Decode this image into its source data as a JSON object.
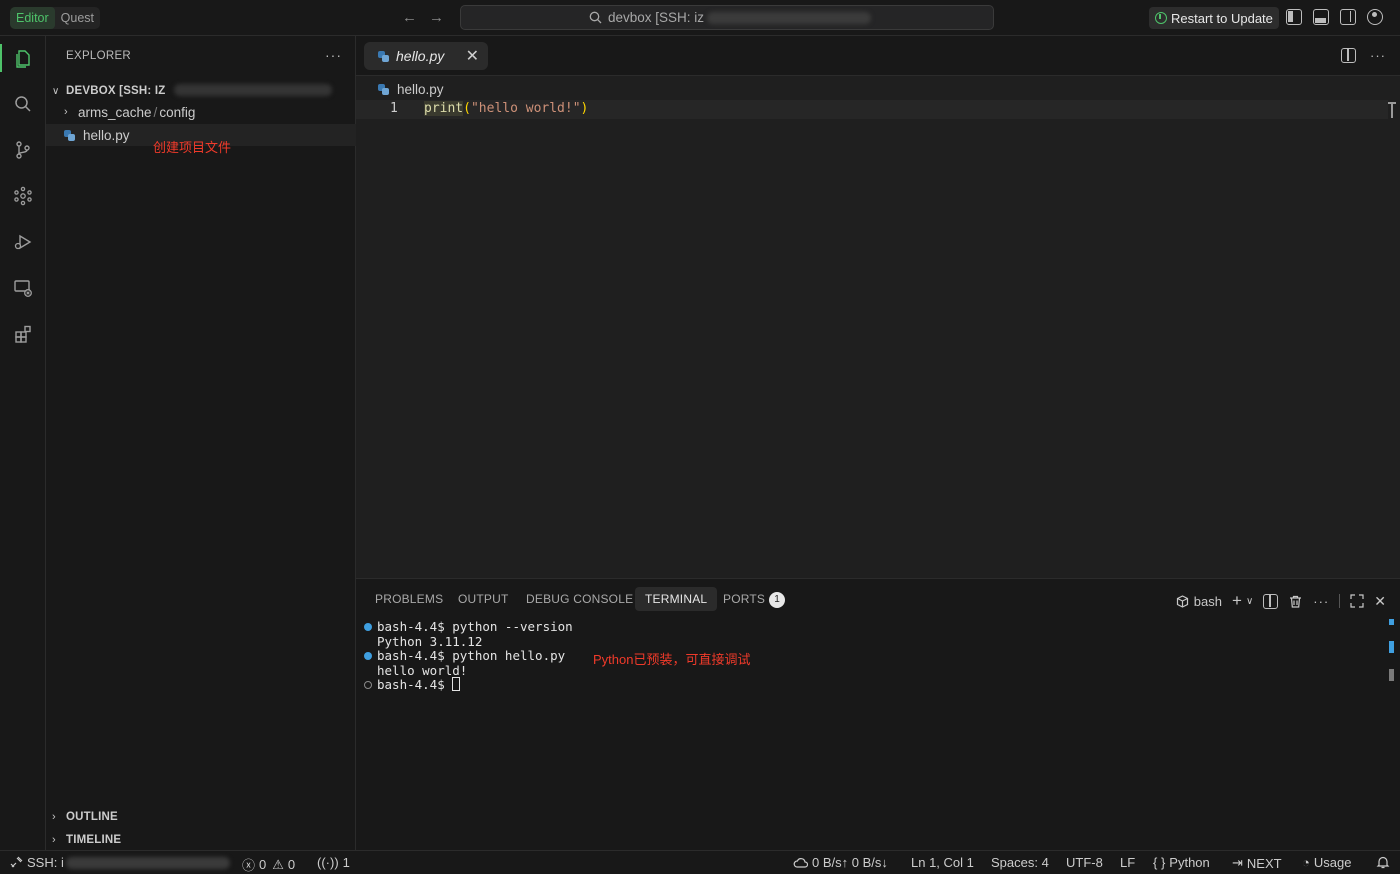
{
  "titlebar": {
    "mode_tabs": [
      "Editor",
      "Quest"
    ],
    "search_label": "devbox [SSH: iz",
    "restart_label": "Restart to Update"
  },
  "sidebar": {
    "title": "EXPLORER",
    "folder_name": "DEVBOX [SSH: IZ",
    "tree": [
      {
        "name": "arms_cache",
        "sub": "config",
        "type": "folder"
      },
      {
        "name": "hello.py",
        "type": "python-file"
      }
    ],
    "annotation": "创建项目文件",
    "sections": [
      "OUTLINE",
      "TIMELINE"
    ]
  },
  "editor": {
    "tab_label": "hello.py",
    "breadcrumb": "hello.py",
    "line_number": "1",
    "code": {
      "fn": "print",
      "open": "(",
      "str": "\"hello world!\"",
      "close": ")"
    }
  },
  "panel": {
    "tabs": [
      "PROBLEMS",
      "OUTPUT",
      "DEBUG CONSOLE",
      "TERMINAL",
      "PORTS"
    ],
    "active_tab": "TERMINAL",
    "ports_badge": "1",
    "shell_label": "bash",
    "terminal": [
      "bash-4.4$ python --version",
      "Python 3.11.12",
      "bash-4.4$ python hello.py",
      "hello world!",
      "bash-4.4$ "
    ],
    "annotation": "Python已预装，可直接调试"
  },
  "statusbar": {
    "remote": "SSH: i",
    "errors": "0",
    "warnings": "0",
    "ports": "1",
    "network": "0 B/s↑ 0 B/s↓",
    "position": "Ln 1, Col 1",
    "spaces": "Spaces: 4",
    "encoding": "UTF-8",
    "eol": "LF",
    "language": "Python",
    "next": "NEXT",
    "usage": "Usage"
  },
  "colors": {
    "accent_green": "#4ec36a",
    "annotation_red": "#f03a2a",
    "terminal_dot_blue": "#3f9fe0"
  }
}
